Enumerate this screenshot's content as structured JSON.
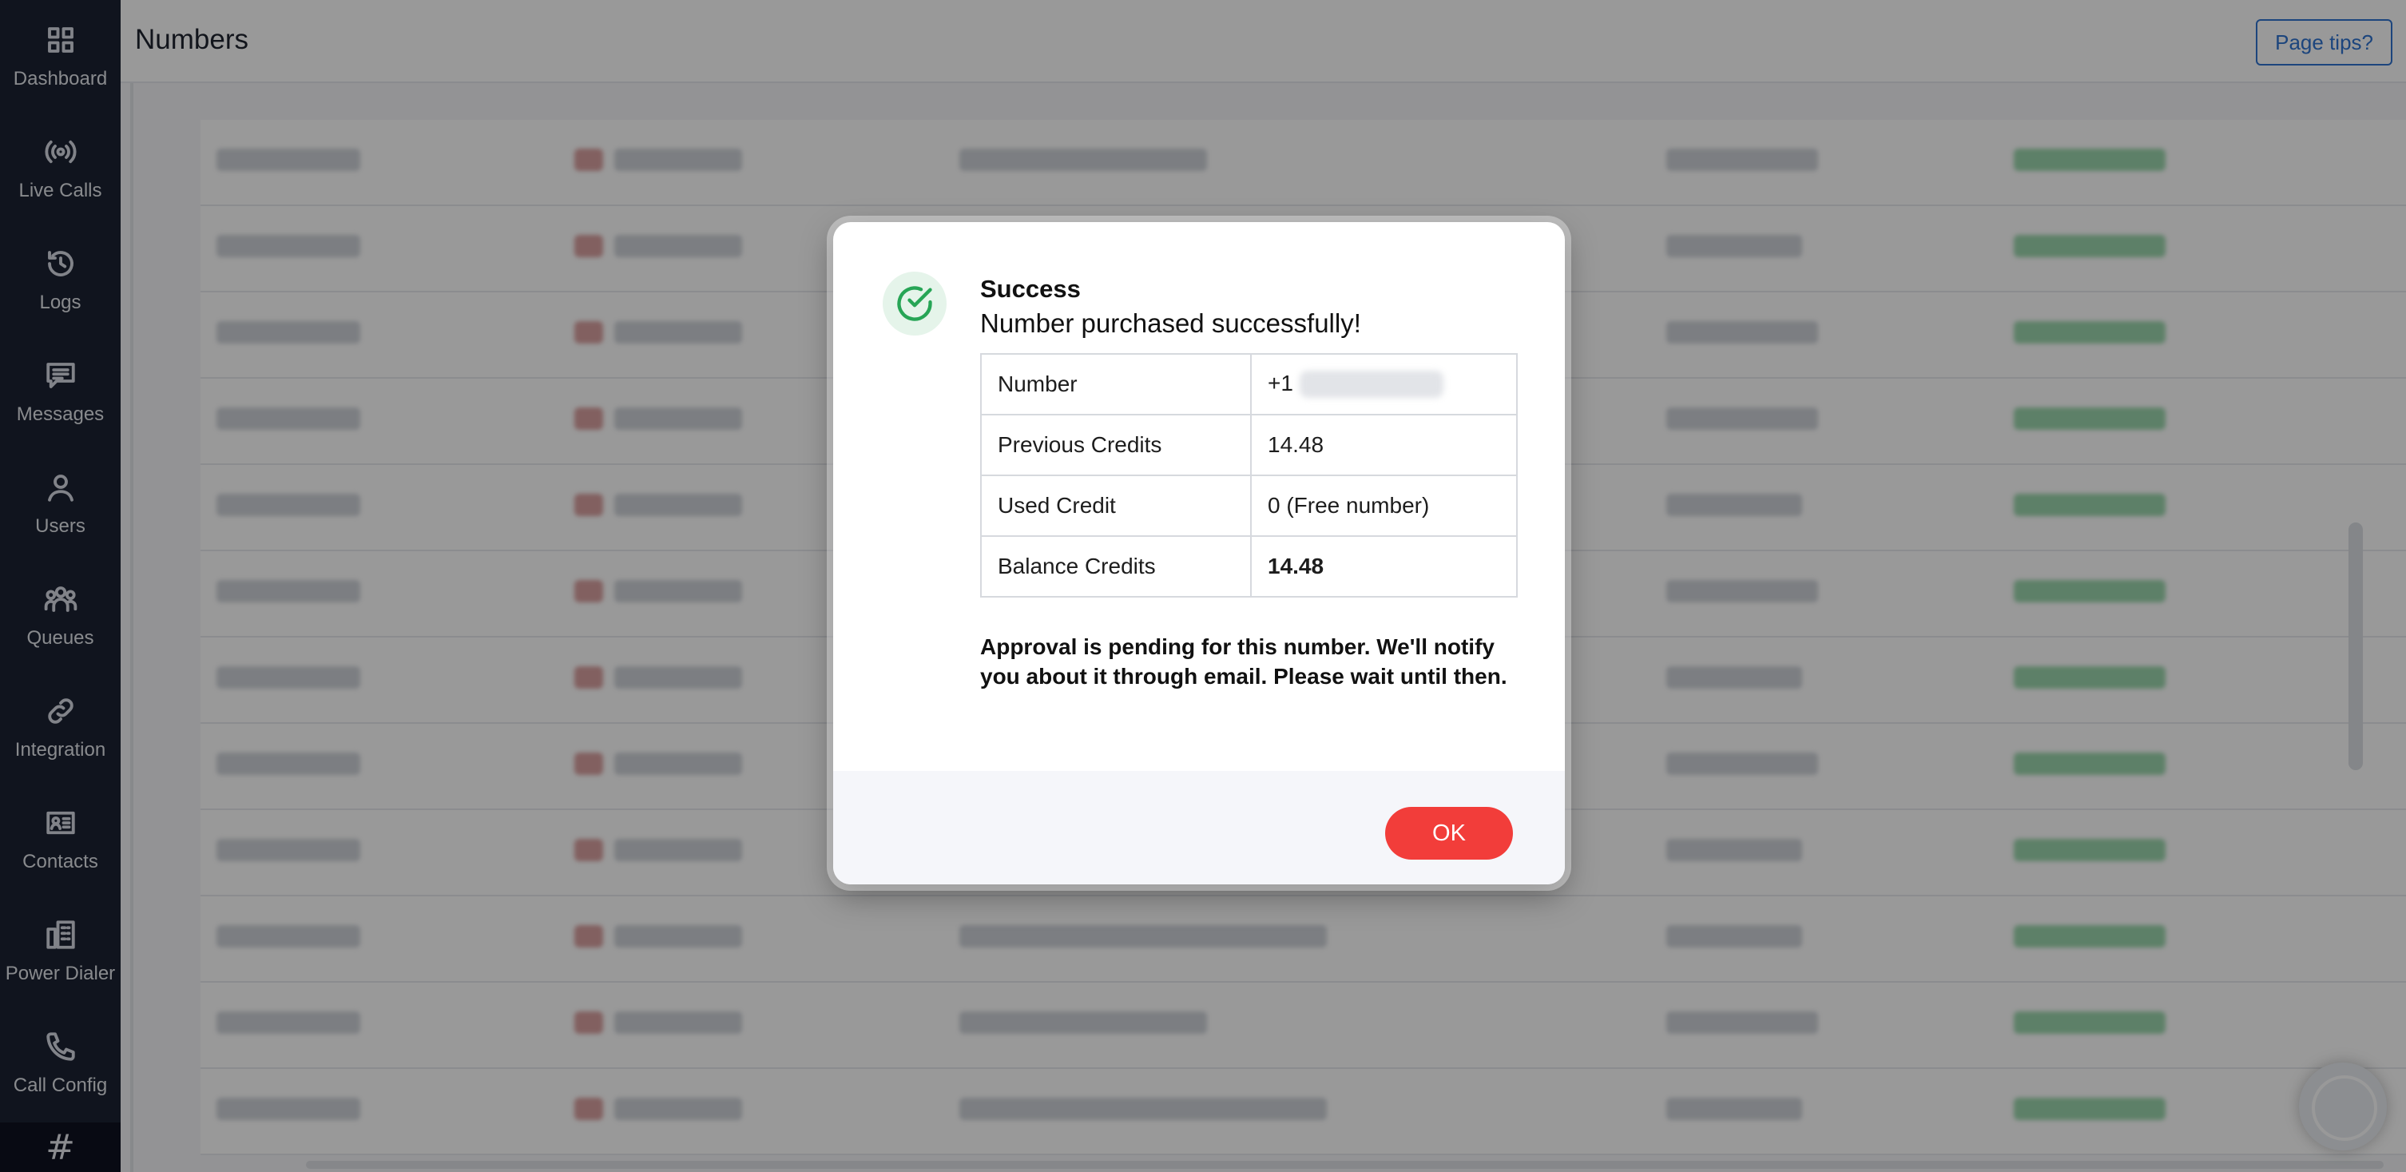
{
  "sidebar": {
    "items": [
      {
        "label": "Dashboard",
        "icon": "dashboard-grid-icon"
      },
      {
        "label": "Live Calls",
        "icon": "broadcast-icon"
      },
      {
        "label": "Logs",
        "icon": "history-icon"
      },
      {
        "label": "Messages",
        "icon": "message-icon"
      },
      {
        "label": "Users",
        "icon": "user-icon"
      },
      {
        "label": "Queues",
        "icon": "group-icon"
      },
      {
        "label": "Integration",
        "icon": "link-icon"
      },
      {
        "label": "Contacts",
        "icon": "contact-card-icon"
      },
      {
        "label": "Power Dialer",
        "icon": "phone-building-icon"
      },
      {
        "label": "Call Config",
        "icon": "phone-icon"
      }
    ],
    "hash_symbol": "#"
  },
  "header": {
    "title": "Numbers",
    "tips_label": "Page tips?"
  },
  "modal": {
    "title": "Success",
    "message": "Number purchased successfully!",
    "rows": [
      {
        "label": "Number",
        "value": "+1"
      },
      {
        "label": "Previous Credits",
        "value": "14.48"
      },
      {
        "label": "Used Credit",
        "value": "0 (Free number)"
      },
      {
        "label": "Balance Credits",
        "value": "14.48"
      }
    ],
    "note": "Approval is pending for this number. We'll notify you about it through email. Please wait until then.",
    "ok_label": "OK"
  },
  "colors": {
    "sidebar_bg": "#1c2233",
    "accent_blue": "#2f74d0",
    "ok_red": "#f23d3a",
    "success_green": "#27a556"
  }
}
